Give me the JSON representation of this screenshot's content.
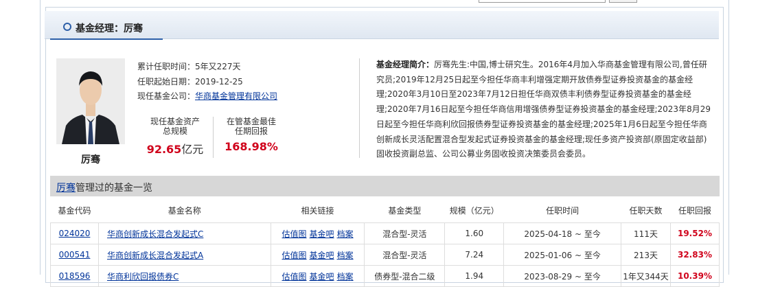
{
  "header": {
    "title": "基金经理：厉骞"
  },
  "manager": {
    "name": "厉骞",
    "tenure_label": "累计任职时间：",
    "tenure": "5年又227天",
    "start_label": "任职起始日期：",
    "start_date": "2019-12-25",
    "company_label": "现任基金公司：",
    "company": "华商基金管理有限公司"
  },
  "stats": {
    "assets_label_1": "现任基金资产",
    "assets_label_2": "总规模",
    "assets_value": "92.65",
    "assets_unit": "亿元",
    "return_label_1": "在管基金最佳",
    "return_label_2": "任期回报",
    "return_value": "168.98%"
  },
  "bio": {
    "label": "基金经理简介：",
    "text": "厉骞先生:中国,博士研究生。2016年4月加入华商基金管理有限公司,曾任研究员;2019年12月25日起至今担任华商丰利增强定期开放债券型证券投资基金的基金经理;2020年3月10日至2023年7月12日担任华商双债丰利债券型证券投资基金的基金经理;2020年7月16日起至今担任华商信用增强债券型证券投资基金的基金经理;2023年8月29日起至今担任华商利欣回报债券型证券投资基金的基金经理;2025年1月6日起至今担任华商创新成长灵活配置混合型发起式证券投资基金的基金经理;现任多资产投资部(原固定收益部)固收投资副总监、公司公募业务固收投资决策委员会委员。"
  },
  "section": {
    "name_link": "厉骞",
    "suffix": "管理过的基金一览"
  },
  "table": {
    "headers": [
      "基金代码",
      "基金名称",
      "相关链接",
      "基金类型",
      "规模（亿元）",
      "任职时间",
      "任职天数",
      "任职回报"
    ],
    "link_labels": [
      "估值图",
      "基金吧",
      "档案"
    ],
    "rows": [
      {
        "code": "024020",
        "name": "华商创新成长混合发起式C",
        "type": "混合型-灵活",
        "size": "1.60",
        "period": "2025-04-18 ~ 至今",
        "days": "111天",
        "return": "19.52%"
      },
      {
        "code": "000541",
        "name": "华商创新成长混合发起式A",
        "type": "混合型-灵活",
        "size": "7.24",
        "period": "2025-01-06 ~ 至今",
        "days": "213天",
        "return": "32.83%"
      },
      {
        "code": "018596",
        "name": "华商利欣回报债券C",
        "type": "债券型-混合二级",
        "size": "1.94",
        "period": "2023-08-29 ~ 至今",
        "days": "1年又344天",
        "return": "10.39%"
      }
    ]
  },
  "colors": {
    "accent": "#2d5fa8",
    "link": "#003399",
    "positive": "#d0021b"
  }
}
